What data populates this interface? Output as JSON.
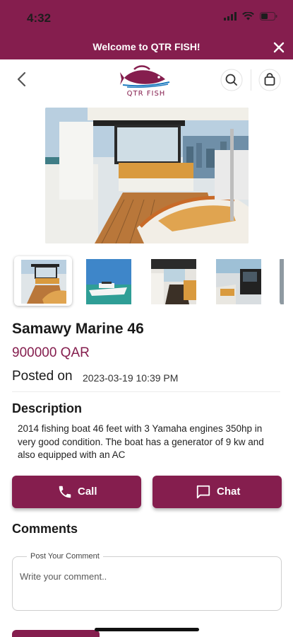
{
  "status_bar": {
    "time": "4:32"
  },
  "banner": {
    "text": "Welcome to QTR FISH!"
  },
  "header": {
    "logo_text": "QTR FISH"
  },
  "listing": {
    "title": "Samawy Marine 46",
    "price": "900000 QAR",
    "posted_label": "Posted on",
    "posted_value": "2023-03-19 10:39 PM",
    "description_heading": "Description",
    "description": "2014 fishing boat 46 feet with 3 Yamaha engines 350hp in very good condition. The boat has a generator of 9 kw and also equipped with an AC"
  },
  "actions": {
    "call_label": "Call",
    "chat_label": "Chat"
  },
  "comments": {
    "heading": "Comments",
    "field_label": "Post Your Comment",
    "placeholder": "Write your comment.."
  },
  "colors": {
    "brand": "#851e4e"
  }
}
